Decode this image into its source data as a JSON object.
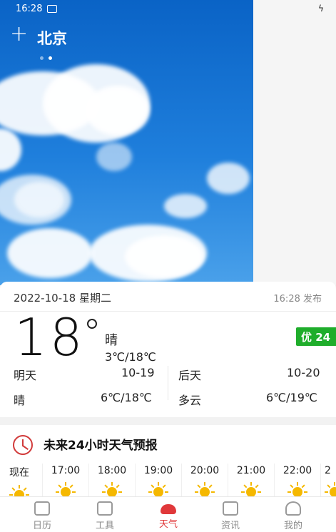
{
  "status_bar": {
    "time": "16:28",
    "bolt": "ϟ"
  },
  "header": {
    "add_label": "+",
    "city": "北京",
    "page_dots": 2,
    "active_dot": 1
  },
  "weather": {
    "date": "2022-10-18  星期二",
    "publish": "16:28 发布",
    "temperature": "18",
    "condition": "晴",
    "range": "3℃/18℃",
    "aqi": "优 24",
    "aqi_color": "#1fad2b",
    "tomorrow": {
      "label": "明天",
      "date": "10-19",
      "condition": "晴",
      "range": "6℃/18℃"
    },
    "day_after": {
      "label": "后天",
      "date": "10-20",
      "condition": "多云",
      "range": "6℃/19℃"
    }
  },
  "hourly": {
    "title": "未来24小时天气预报",
    "icon": "clock-icon",
    "hours": [
      {
        "time": "现在",
        "icon": "sun-icon"
      },
      {
        "time": "17:00",
        "icon": "sun-icon"
      },
      {
        "time": "18:00",
        "icon": "sun-icon"
      },
      {
        "time": "19:00",
        "icon": "sun-icon"
      },
      {
        "time": "20:00",
        "icon": "sun-icon"
      },
      {
        "time": "21:00",
        "icon": "sun-icon"
      },
      {
        "time": "22:00",
        "icon": "sun-icon"
      },
      {
        "time": "2",
        "icon": "sun-icon"
      }
    ]
  },
  "bottom_nav": [
    {
      "label": "日历",
      "icon": "calendar-icon"
    },
    {
      "label": "工具",
      "icon": "toolbox-icon"
    },
    {
      "label": "天气",
      "icon": "cloud-icon",
      "active": true
    },
    {
      "label": "资讯",
      "icon": "news-icon"
    },
    {
      "label": "我的",
      "icon": "profile-icon"
    }
  ],
  "accent_color": "#e0383a"
}
